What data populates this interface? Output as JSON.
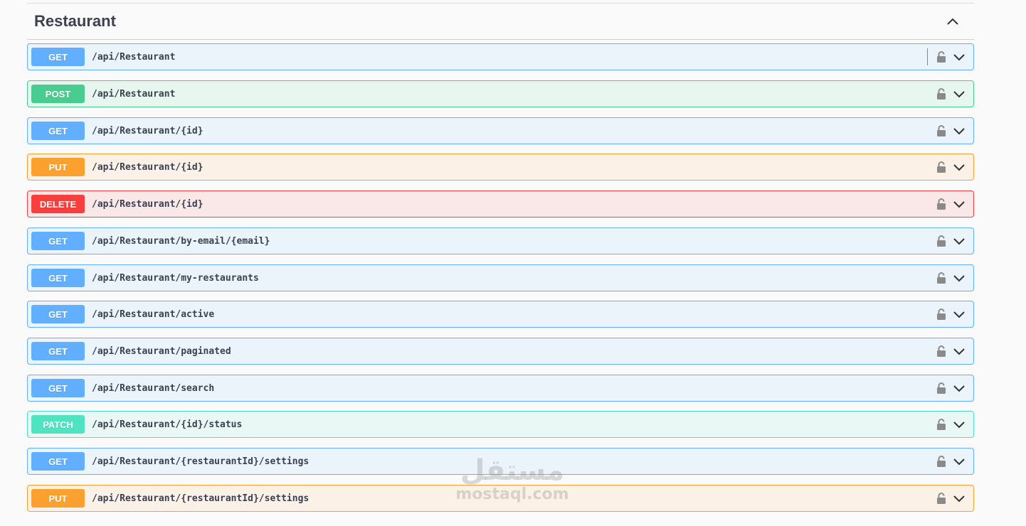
{
  "section": {
    "title": "Restaurant",
    "collapse_icon": "chevron-up-icon"
  },
  "colors": {
    "get": "#61affe",
    "post": "#49cc90",
    "put": "#fca130",
    "delete": "#f93e3e",
    "patch": "#50e3c2"
  },
  "operations": [
    {
      "method": "GET",
      "path": "/api/Restaurant"
    },
    {
      "method": "POST",
      "path": "/api/Restaurant"
    },
    {
      "method": "GET",
      "path": "/api/Restaurant/{id}"
    },
    {
      "method": "PUT",
      "path": "/api/Restaurant/{id}"
    },
    {
      "method": "DELETE",
      "path": "/api/Restaurant/{id}"
    },
    {
      "method": "GET",
      "path": "/api/Restaurant/by-email/{email}"
    },
    {
      "method": "GET",
      "path": "/api/Restaurant/my-restaurants"
    },
    {
      "method": "GET",
      "path": "/api/Restaurant/active"
    },
    {
      "method": "GET",
      "path": "/api/Restaurant/paginated"
    },
    {
      "method": "GET",
      "path": "/api/Restaurant/search"
    },
    {
      "method": "PATCH",
      "path": "/api/Restaurant/{id}/status"
    },
    {
      "method": "GET",
      "path": "/api/Restaurant/{restaurantId}/settings"
    },
    {
      "method": "PUT",
      "path": "/api/Restaurant/{restaurantId}/settings"
    }
  ],
  "watermark": {
    "arabic": "مستقل",
    "latin": "mostaql.com"
  }
}
